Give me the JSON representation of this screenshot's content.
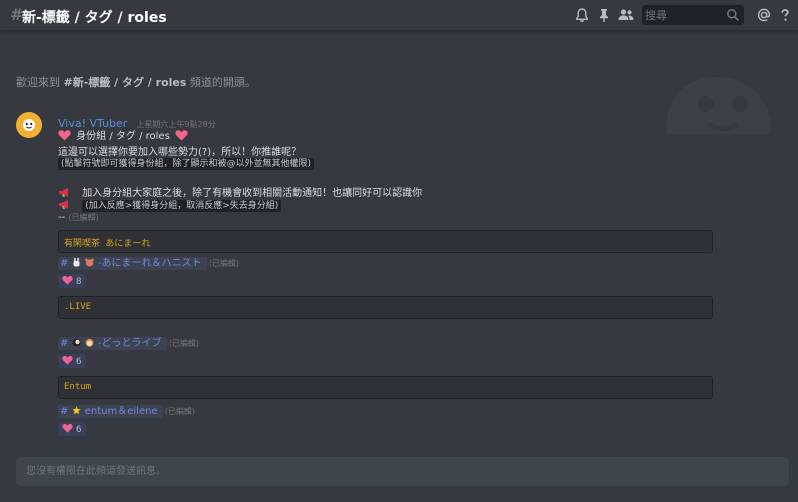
{
  "header": {
    "hash": "#",
    "title": "新-標籤 / タグ / roles",
    "search_placeholder": "搜尋",
    "icons": [
      "bell-icon",
      "pin-icon",
      "members-icon",
      "search-icon",
      "at-icon",
      "help-icon"
    ]
  },
  "welcome": {
    "prefix": "歡迎來到",
    "channel": "#新-標籤 / タグ / roles",
    "suffix": "頻道的開頭。"
  },
  "message": {
    "author": "Viva! VTuber",
    "timestamp": "上星期六上午9點28分",
    "title": "身份組 / タグ / roles",
    "line1": "這邊可以選擇你要加入哪些勢力(?)，所以！你推誰呢？",
    "line2": "(點擊符號即可獲得身份組，除了顯示和被@以外並無其他權限)",
    "line3": "加入身分組大家庭之後，除了有機會收到相關活動通知！也讓同好可以認識你",
    "line4": "(加入反應>獲得身分組，取消反應>失去身分組)",
    "line5": "--",
    "edited": "(已編輯)",
    "blocks": [
      {
        "code": "有閑喫茶 あにまーれ",
        "channel_hash": "#",
        "channel": "-あにまーれ＆ハニスト",
        "edited": "(已編輯)",
        "reaction_count": "8"
      },
      {
        "code": ".LIVE",
        "channel_hash": "#",
        "channel": "-どっとライブ",
        "edited": "(已編輯)",
        "reaction_count": "6"
      },
      {
        "code": "Entum",
        "channel_hash": "#",
        "channel": "entum＆eilene",
        "edited": "(已編輯)",
        "reaction_count": "6"
      }
    ]
  },
  "composer": {
    "placeholder": "您沒有權限在此頻道發送訊息。"
  },
  "colors": {
    "background": "#36393f",
    "author": "#5b8fd9",
    "code_text": "#d9a31f",
    "mention": "#7289da",
    "heart": "#f0658e"
  }
}
